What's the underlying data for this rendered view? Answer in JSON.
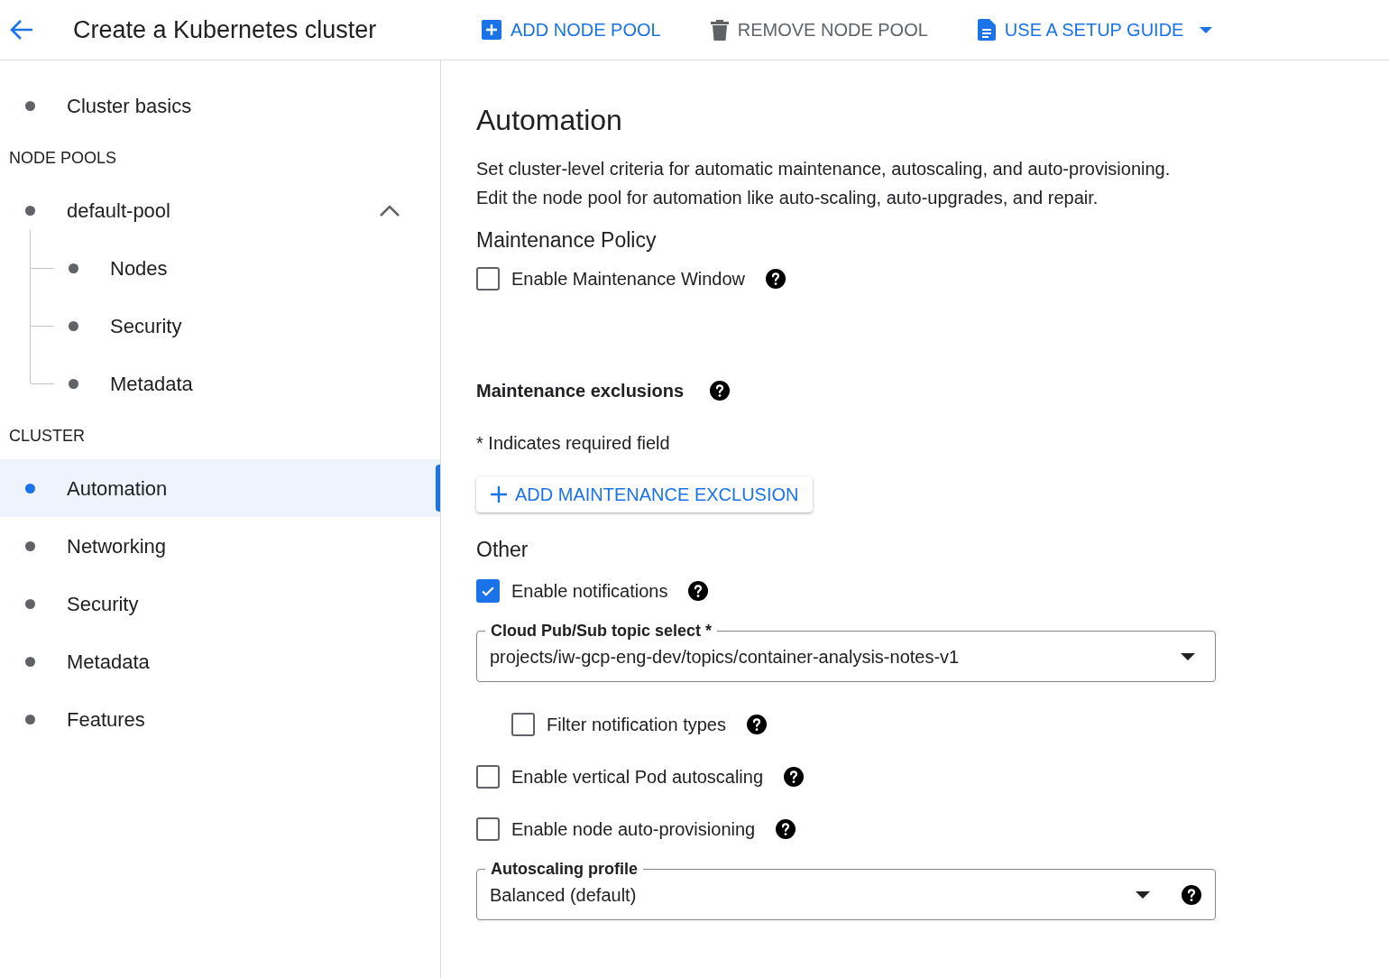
{
  "header": {
    "title": "Create a Kubernetes cluster",
    "actions": [
      {
        "kind": "add",
        "label": "ADD NODE POOL",
        "disabled": false
      },
      {
        "kind": "delete",
        "label": "REMOVE NODE POOL",
        "disabled": true
      },
      {
        "kind": "guide",
        "label": "USE A SETUP GUIDE",
        "disabled": false
      }
    ]
  },
  "sidebar": {
    "items": [
      {
        "kind": "item",
        "label": "Cluster basics",
        "selected": false
      },
      {
        "kind": "heading",
        "label": "NODE POOLS"
      },
      {
        "kind": "item",
        "label": "default-pool",
        "selected": false,
        "expanded": true,
        "children": [
          {
            "kind": "item",
            "label": "Nodes",
            "selected": false
          },
          {
            "kind": "item",
            "label": "Security",
            "selected": false
          },
          {
            "kind": "item",
            "label": "Metadata",
            "selected": false
          }
        ]
      },
      {
        "kind": "heading",
        "label": "CLUSTER"
      },
      {
        "kind": "item",
        "label": "Automation",
        "selected": true
      },
      {
        "kind": "item",
        "label": "Networking",
        "selected": false
      },
      {
        "kind": "item",
        "label": "Security",
        "selected": false
      },
      {
        "kind": "item",
        "label": "Metadata",
        "selected": false
      },
      {
        "kind": "item",
        "label": "Features",
        "selected": false
      }
    ]
  },
  "main": {
    "title": "Automation",
    "description": [
      "Set cluster-level criteria for automatic maintenance, autoscaling, and auto-provisioning.",
      "Edit the node pool for automation like auto-scaling, auto-upgrades, and repair."
    ],
    "maintenance_policy": {
      "heading": "Maintenance Policy",
      "checkbox": {
        "label": "Enable Maintenance Window",
        "checked": false
      }
    },
    "exclusions": {
      "heading": "Maintenance exclusions",
      "note": "* Indicates required field",
      "button": "ADD MAINTENANCE EXCLUSION"
    },
    "other": {
      "heading": "Other",
      "options": [
        {
          "kind": "checkbox",
          "label": "Enable notifications",
          "checked": true,
          "indented": false
        },
        {
          "kind": "select",
          "label": "Cloud Pub/Sub topic select *",
          "value": "projects/iw-gcp-eng-dev/topics/container-analysis-notes-v1",
          "help": false
        },
        {
          "kind": "checkbox",
          "label": "Filter notification types",
          "checked": false,
          "indented": true
        },
        {
          "kind": "checkbox",
          "label": "Enable vertical Pod autoscaling",
          "checked": false,
          "indented": false
        },
        {
          "kind": "checkbox",
          "label": "Enable node auto-provisioning",
          "checked": false,
          "indented": false
        },
        {
          "kind": "select",
          "label": "Autoscaling profile",
          "value": "Balanced (default)",
          "help": true
        }
      ]
    }
  }
}
